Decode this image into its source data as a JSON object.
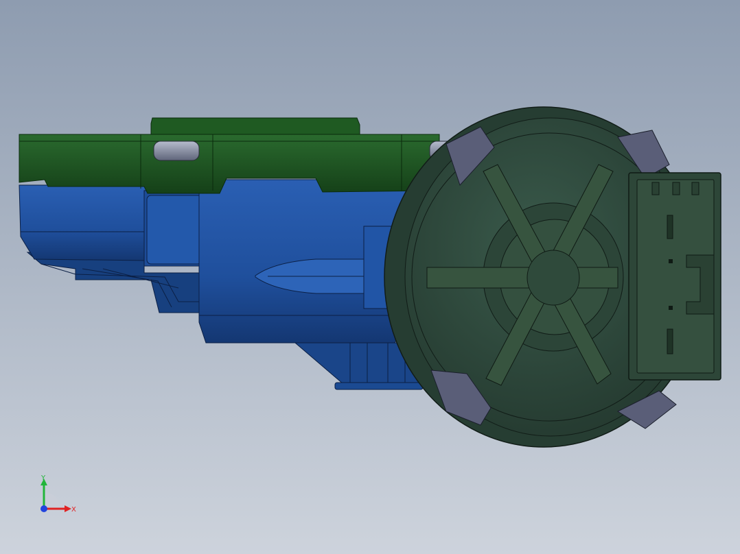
{
  "viewport": {
    "background_top": "#8e9cb0",
    "background_bottom": "#cdd3dc"
  },
  "model": {
    "body_color": "#1f4f9c",
    "body_dark": "#153a77",
    "cover_color": "#1b5020",
    "cover_dark": "#123a16",
    "wheel_color": "#2f4a3e",
    "wheel_dark": "#1e3229",
    "pad_color": "#5a5e78",
    "screw_color": "#8a90a6",
    "connector_color": "#35503f"
  },
  "triad": {
    "y_label": "Y",
    "x_label": "X",
    "y_color": "#22b53a",
    "x_color": "#e02222",
    "z_color": "#2244dd"
  }
}
